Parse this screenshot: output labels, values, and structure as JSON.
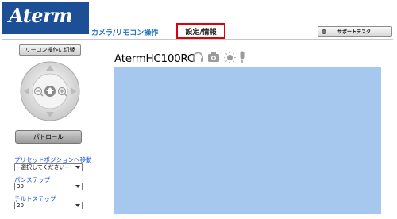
{
  "header": {
    "logo_text": "Aterm",
    "camera_nav": "カメラ/リモコン操作",
    "settings_nav": "設定/情報",
    "support_button": "サポートデスク"
  },
  "left_panel": {
    "remote_toggle": "リモコン操作に切替",
    "patrol_button": "パトロール",
    "preset": {
      "label": "プリセットポジションへ移動",
      "value": "--選択してください--"
    },
    "pan_step": {
      "label": "パンステップ",
      "value": "30"
    },
    "tilt_step": {
      "label": "チルトステップ",
      "value": "20"
    }
  },
  "main": {
    "camera_name": "AtermHC100RC",
    "toolbar_icons": [
      "headphones-icon",
      "camera-icon",
      "light-icon",
      "microphone-icon"
    ]
  },
  "colors": {
    "logo_bg": "#1d4f96",
    "nav_blue": "#1f70c8",
    "active_border": "#e0000a",
    "link_blue": "#1a4fd6",
    "video_bg": "#a6c8ee"
  }
}
